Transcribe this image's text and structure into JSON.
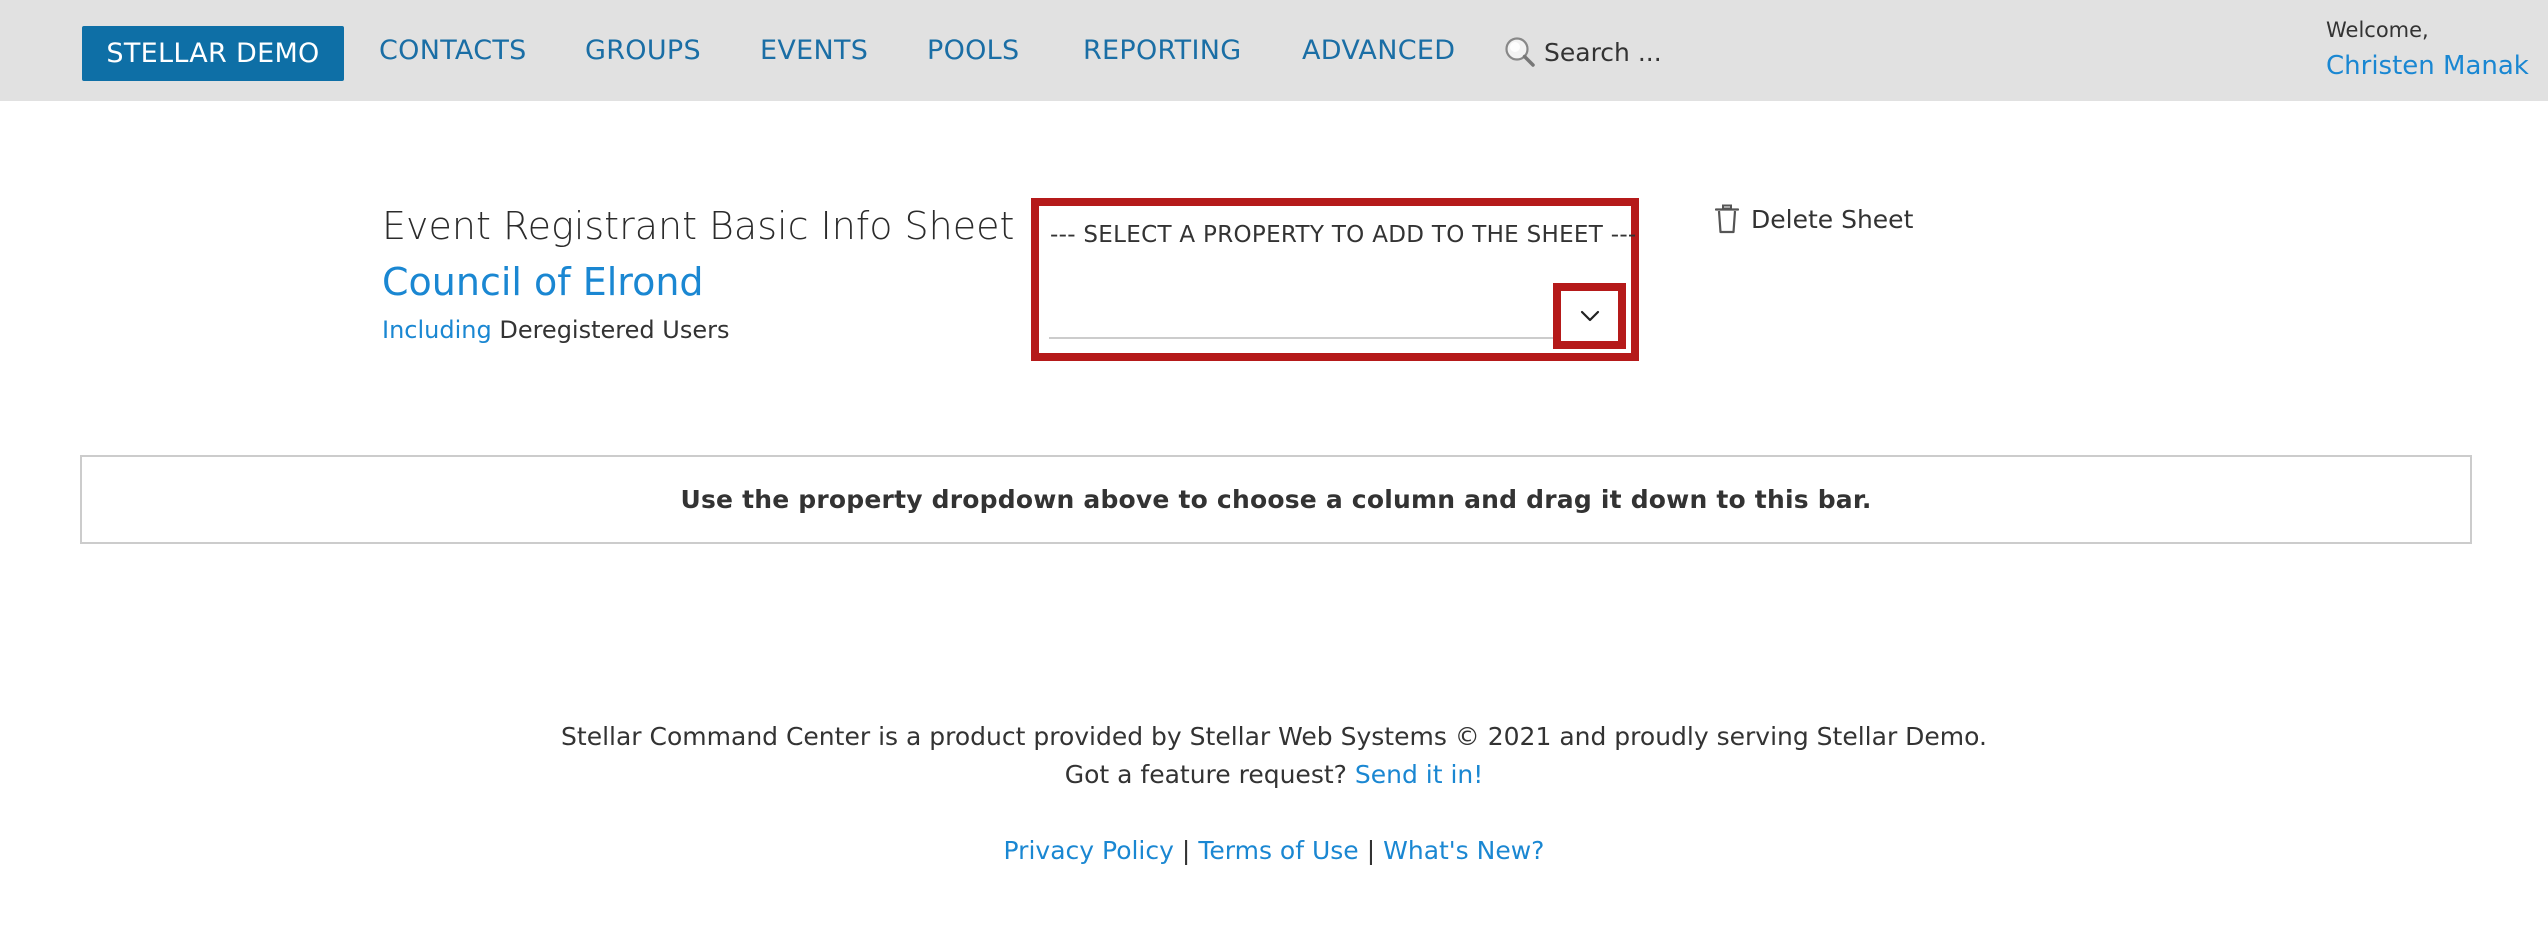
{
  "nav": {
    "brand": "STELLAR DEMO",
    "items": [
      {
        "label": "CONTACTS"
      },
      {
        "label": "GROUPS"
      },
      {
        "label": "EVENTS"
      },
      {
        "label": "POOLS"
      },
      {
        "label": "REPORTING"
      },
      {
        "label": "ADVANCED"
      }
    ],
    "search": {
      "placeholder": "Search ...",
      "value": "",
      "icon": "search-icon"
    },
    "welcome": "Welcome,",
    "user_name": "Christen Manak"
  },
  "sheet": {
    "title": "Event Registrant Basic Info Sheet",
    "event_name": "Council of Elrond",
    "including_link": "Including",
    "including_text": " Deregistered Users"
  },
  "property_select": {
    "label": "--- SELECT A PROPERTY TO ADD TO THE SHEET ---",
    "toggle_icon": "chevron-down-icon",
    "highlight_color": "#b51a1a"
  },
  "actions": {
    "delete_sheet": "Delete Sheet",
    "delete_icon": "trash-icon"
  },
  "drop_bar": {
    "text": "Use the property dropdown above to choose a column and drag it down to this bar."
  },
  "footer": {
    "line1": "Stellar Command Center is a product provided by Stellar Web Systems © 2021 and proudly serving Stellar Demo.",
    "line2_prefix": "Got a feature request? ",
    "line2_link": "Send it in!",
    "links": {
      "privacy": "Privacy Policy",
      "terms": "Terms of Use",
      "whats_new": "What's New?",
      "separator": "|"
    }
  },
  "colors": {
    "brand": "#0e6fa6",
    "nav_link": "#1a6ea5",
    "link": "#1a87d2",
    "topbar": "#e1e1e1",
    "highlight": "#b51a1a"
  }
}
